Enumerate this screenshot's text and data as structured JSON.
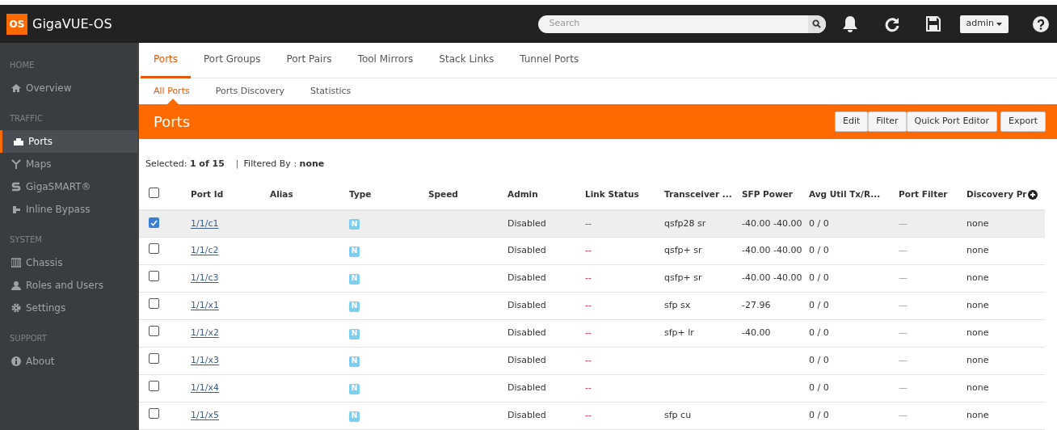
{
  "header": {
    "logo": "OS",
    "title": "GigaVUE-OS",
    "search": {
      "placeholder": "Search"
    },
    "user": "admin"
  },
  "sidebar": [
    {
      "heading": "HOME",
      "items": [
        {
          "label": "Overview",
          "kind": "home",
          "selected": false
        }
      ]
    },
    {
      "heading": "TRAFFIC",
      "items": [
        {
          "label": "Ports",
          "kind": "port",
          "selected": true
        },
        {
          "label": "Maps",
          "kind": "map",
          "selected": false
        },
        {
          "label": "GigaSMART®",
          "kind": "smart",
          "selected": false
        },
        {
          "label": "Inline Bypass",
          "kind": "bypass",
          "selected": false
        }
      ]
    },
    {
      "heading": "SYSTEM",
      "items": [
        {
          "label": "Chassis",
          "kind": "chassis",
          "selected": false
        },
        {
          "label": "Roles and Users",
          "kind": "user",
          "selected": false
        },
        {
          "label": "Settings",
          "kind": "gear",
          "selected": false
        }
      ]
    },
    {
      "heading": "SUPPORT",
      "items": [
        {
          "label": "About",
          "kind": "info",
          "selected": false
        }
      ]
    }
  ],
  "tabs": [
    {
      "label": "Ports",
      "selected": true
    },
    {
      "label": "Port Groups",
      "selected": false
    },
    {
      "label": "Port Pairs",
      "selected": false
    },
    {
      "label": "Tool Mirrors",
      "selected": false
    },
    {
      "label": "Stack Links",
      "selected": false
    },
    {
      "label": "Tunnel Ports",
      "selected": false
    }
  ],
  "subtabs": [
    {
      "label": "All Ports",
      "selected": true
    },
    {
      "label": "Ports Discovery",
      "selected": false
    },
    {
      "label": "Statistics",
      "selected": false
    }
  ],
  "banner": {
    "title": "Ports",
    "buttons": [
      "Edit",
      "Filter",
      "Quick Port Editor",
      "Export"
    ]
  },
  "selection": {
    "label": "Selected:",
    "value": "1 of 15",
    "separator": "|",
    "filter_label": "Filtered By :",
    "filter_value": "none"
  },
  "table": {
    "all_checked": false,
    "columns": [
      "Port Id",
      "Alias",
      "Type",
      "Speed",
      "Admin",
      "Link Status",
      "Transceiver ...",
      "SFP Power",
      "Avg Util Tx/R...",
      "Port Filter",
      "Discovery Pr"
    ],
    "rows": [
      {
        "checked": true,
        "port_id": "1/1/c1",
        "type": "N",
        "admin": "Disabled",
        "link_status": "--",
        "transceiver": "qsfp28 sr",
        "sfp_power": "-40.00 -40.00",
        "avg_util": "0 / 0",
        "port_filter": "—",
        "discovery": "none"
      },
      {
        "checked": false,
        "port_id": "1/1/c2",
        "type": "N",
        "admin": "Disabled",
        "link_status": "--",
        "transceiver": "qsfp+ sr",
        "sfp_power": "-40.00 -40.00",
        "avg_util": "0 / 0",
        "port_filter": "—",
        "discovery": "none"
      },
      {
        "checked": false,
        "port_id": "1/1/c3",
        "type": "N",
        "admin": "Disabled",
        "link_status": "--",
        "transceiver": "qsfp+ sr",
        "sfp_power": "-40.00 -40.00",
        "avg_util": "0 / 0",
        "port_filter": "—",
        "discovery": "none"
      },
      {
        "checked": false,
        "port_id": "1/1/x1",
        "type": "N",
        "admin": "Disabled",
        "link_status": "--",
        "transceiver": "sfp sx",
        "sfp_power": "-27.96",
        "avg_util": "0 / 0",
        "port_filter": "—",
        "discovery": "none"
      },
      {
        "checked": false,
        "port_id": "1/1/x2",
        "type": "N",
        "admin": "Disabled",
        "link_status": "--",
        "transceiver": "sfp+ lr",
        "sfp_power": "-40.00",
        "avg_util": "0 / 0",
        "port_filter": "—",
        "discovery": "none"
      },
      {
        "checked": false,
        "port_id": "1/1/x3",
        "type": "N",
        "admin": "Disabled",
        "link_status": "--",
        "avg_util": "0 / 0",
        "port_filter": "—",
        "discovery": "none"
      },
      {
        "checked": false,
        "port_id": "1/1/x4",
        "type": "N",
        "admin": "Disabled",
        "link_status": "--",
        "avg_util": "0 / 0",
        "port_filter": "—",
        "discovery": "none"
      },
      {
        "checked": false,
        "port_id": "1/1/x5",
        "type": "N",
        "admin": "Disabled",
        "link_status": "--",
        "transceiver": "sfp cu",
        "avg_util": "0 / 0",
        "port_filter": "—",
        "discovery": "none"
      }
    ]
  }
}
